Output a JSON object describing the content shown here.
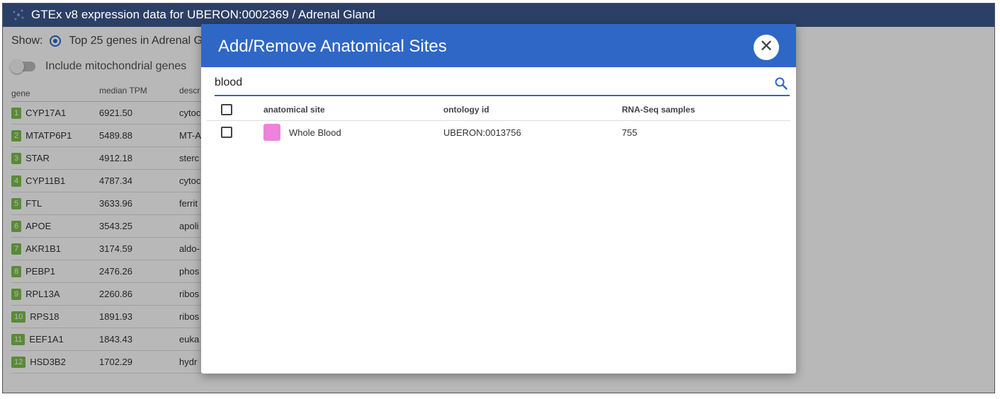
{
  "window": {
    "title": "GTEx v8 expression data for UBERON:0002369 / Adrenal Gland"
  },
  "controls": {
    "show_label": "Show:",
    "radio_label": "Top 25 genes in Adrenal G",
    "toggle_label": "Include mitochondrial genes"
  },
  "gene_table": {
    "headers": {
      "gene": "gene",
      "tpm": "median TPM",
      "desc": "descr"
    },
    "rows": [
      {
        "rank": "1",
        "gene": "CYP17A1",
        "tpm": "6921.50",
        "desc": "cytoc"
      },
      {
        "rank": "2",
        "gene": "MTATP6P1",
        "tpm": "5489.88",
        "desc": "MT-A"
      },
      {
        "rank": "3",
        "gene": "STAR",
        "tpm": "4912.18",
        "desc": "sterc"
      },
      {
        "rank": "4",
        "gene": "CYP11B1",
        "tpm": "4787.34",
        "desc": "cytoc"
      },
      {
        "rank": "5",
        "gene": "FTL",
        "tpm": "3633.96",
        "desc": "ferrit"
      },
      {
        "rank": "6",
        "gene": "APOE",
        "tpm": "3543.25",
        "desc": "apoli"
      },
      {
        "rank": "7",
        "gene": "AKR1B1",
        "tpm": "3174.59",
        "desc": "aldo-"
      },
      {
        "rank": "8",
        "gene": "PEBP1",
        "tpm": "2476.26",
        "desc": "phos"
      },
      {
        "rank": "9",
        "gene": "RPL13A",
        "tpm": "2260.86",
        "desc": "ribos"
      },
      {
        "rank": "10",
        "gene": "RPS18",
        "tpm": "1891.93",
        "desc": "ribos"
      },
      {
        "rank": "11",
        "gene": "EEF1A1",
        "tpm": "1843.43",
        "desc": "euka"
      },
      {
        "rank": "12",
        "gene": "HSD3B2",
        "tpm": "1702.29",
        "desc": "hydr"
      }
    ]
  },
  "modal": {
    "title": "Add/Remove Anatomical Sites",
    "close_glyph": "✕",
    "search_value": "blood",
    "columns": {
      "site": "anatomical site",
      "ontology": "ontology id",
      "samples": "RNA-Seq samples"
    },
    "results": [
      {
        "site": "Whole Blood",
        "ontology": "UBERON:0013756",
        "samples": "755",
        "color": "#ee82dc",
        "checked": false
      }
    ]
  },
  "colors": {
    "title_bar": "#2c4067",
    "accent": "#2f67c7",
    "rank_badge": "#7cbf4e"
  }
}
